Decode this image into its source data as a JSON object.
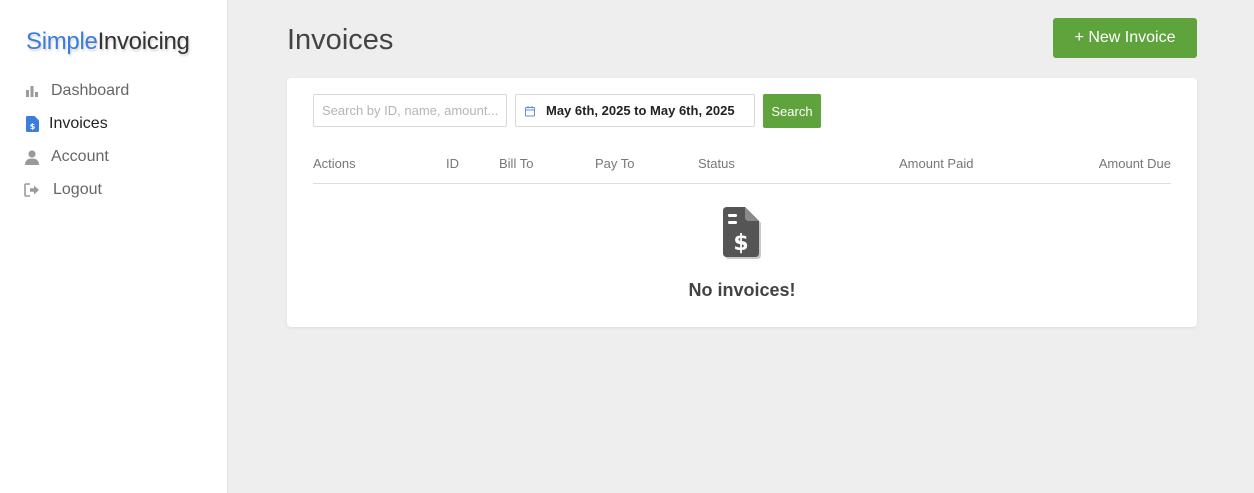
{
  "brand": {
    "part1": "Simple",
    "part2": "Invoicing"
  },
  "sidebar": {
    "items": [
      {
        "label": "Dashboard",
        "icon": "bar-chart-icon"
      },
      {
        "label": "Invoices",
        "icon": "invoice-icon",
        "active": true
      },
      {
        "label": "Account",
        "icon": "user-icon"
      },
      {
        "label": "Logout",
        "icon": "logout-icon"
      }
    ]
  },
  "page": {
    "title": "Invoices"
  },
  "toolbar": {
    "new_invoice_label": "+ New Invoice",
    "search_placeholder": "Search by ID, name, amount...",
    "search_value": "",
    "date_range": "May 6th, 2025 to May 6th, 2025",
    "search_label": "Search"
  },
  "table": {
    "headers": [
      "Actions",
      "ID",
      "Bill To",
      "Pay To",
      "Status",
      "Amount Paid",
      "Amount Due"
    ],
    "rows": []
  },
  "empty_state": {
    "message": "No invoices!",
    "icon": "invoice-dollar-icon"
  },
  "colors": {
    "accent_green": "#5fa33c",
    "brand_blue": "#3b7ddd"
  }
}
